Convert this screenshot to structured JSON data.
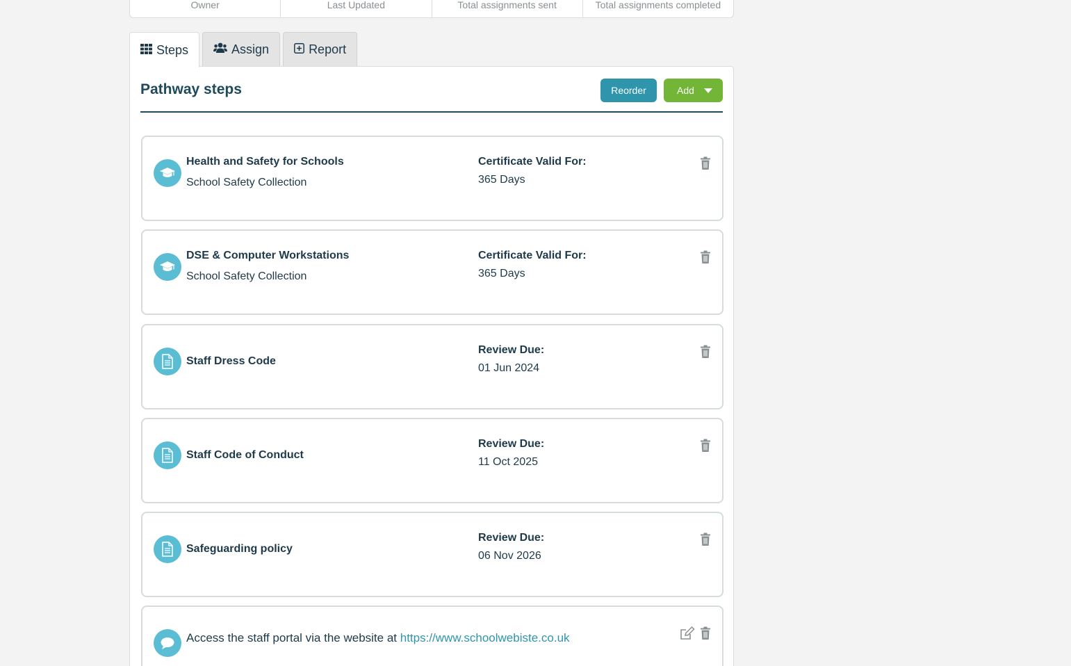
{
  "stats": {
    "labels": [
      "Owner",
      "Last Updated",
      "Total assignments sent",
      "Total assignments completed"
    ]
  },
  "tabs": [
    {
      "label": "Steps",
      "icon": "grid-icon",
      "active": true
    },
    {
      "label": "Assign",
      "icon": "users-icon",
      "active": false
    },
    {
      "label": "Report",
      "icon": "plus-square-icon",
      "active": false
    }
  ],
  "panel": {
    "title": "Pathway steps",
    "reorder_label": "Reorder",
    "add_label": "Add"
  },
  "steps": [
    {
      "type": "course",
      "icon": "graduation-cap-icon",
      "title": "Health and Safety for Schools",
      "subtitle": "School Safety Collection",
      "meta_label": "Certificate Valid For:",
      "meta_value": "365 Days"
    },
    {
      "type": "course",
      "icon": "graduation-cap-icon",
      "title": "DSE & Computer Workstations",
      "subtitle": "School Safety Collection",
      "meta_label": "Certificate Valid For:",
      "meta_value": "365 Days"
    },
    {
      "type": "document",
      "icon": "document-icon",
      "title": "Staff Dress Code",
      "meta_label": "Review Due:",
      "meta_value": "01 Jun 2024"
    },
    {
      "type": "document",
      "icon": "document-icon",
      "title": "Staff Code of Conduct",
      "meta_label": "Review Due:",
      "meta_value": "11 Oct 2025"
    },
    {
      "type": "document",
      "icon": "document-icon",
      "title": "Safeguarding policy",
      "meta_label": "Review Due:",
      "meta_value": "06 Nov 2026"
    },
    {
      "type": "message",
      "icon": "speech-bubble-icon",
      "text": "Access the staff portal via the website at ",
      "link": "https://www.schoolwebiste.co.uk"
    }
  ],
  "colors": {
    "accent": "#2e95ad",
    "add_button": "#72b537",
    "icon_circle": "#5bbdd4",
    "heading": "#1e4a5a"
  }
}
